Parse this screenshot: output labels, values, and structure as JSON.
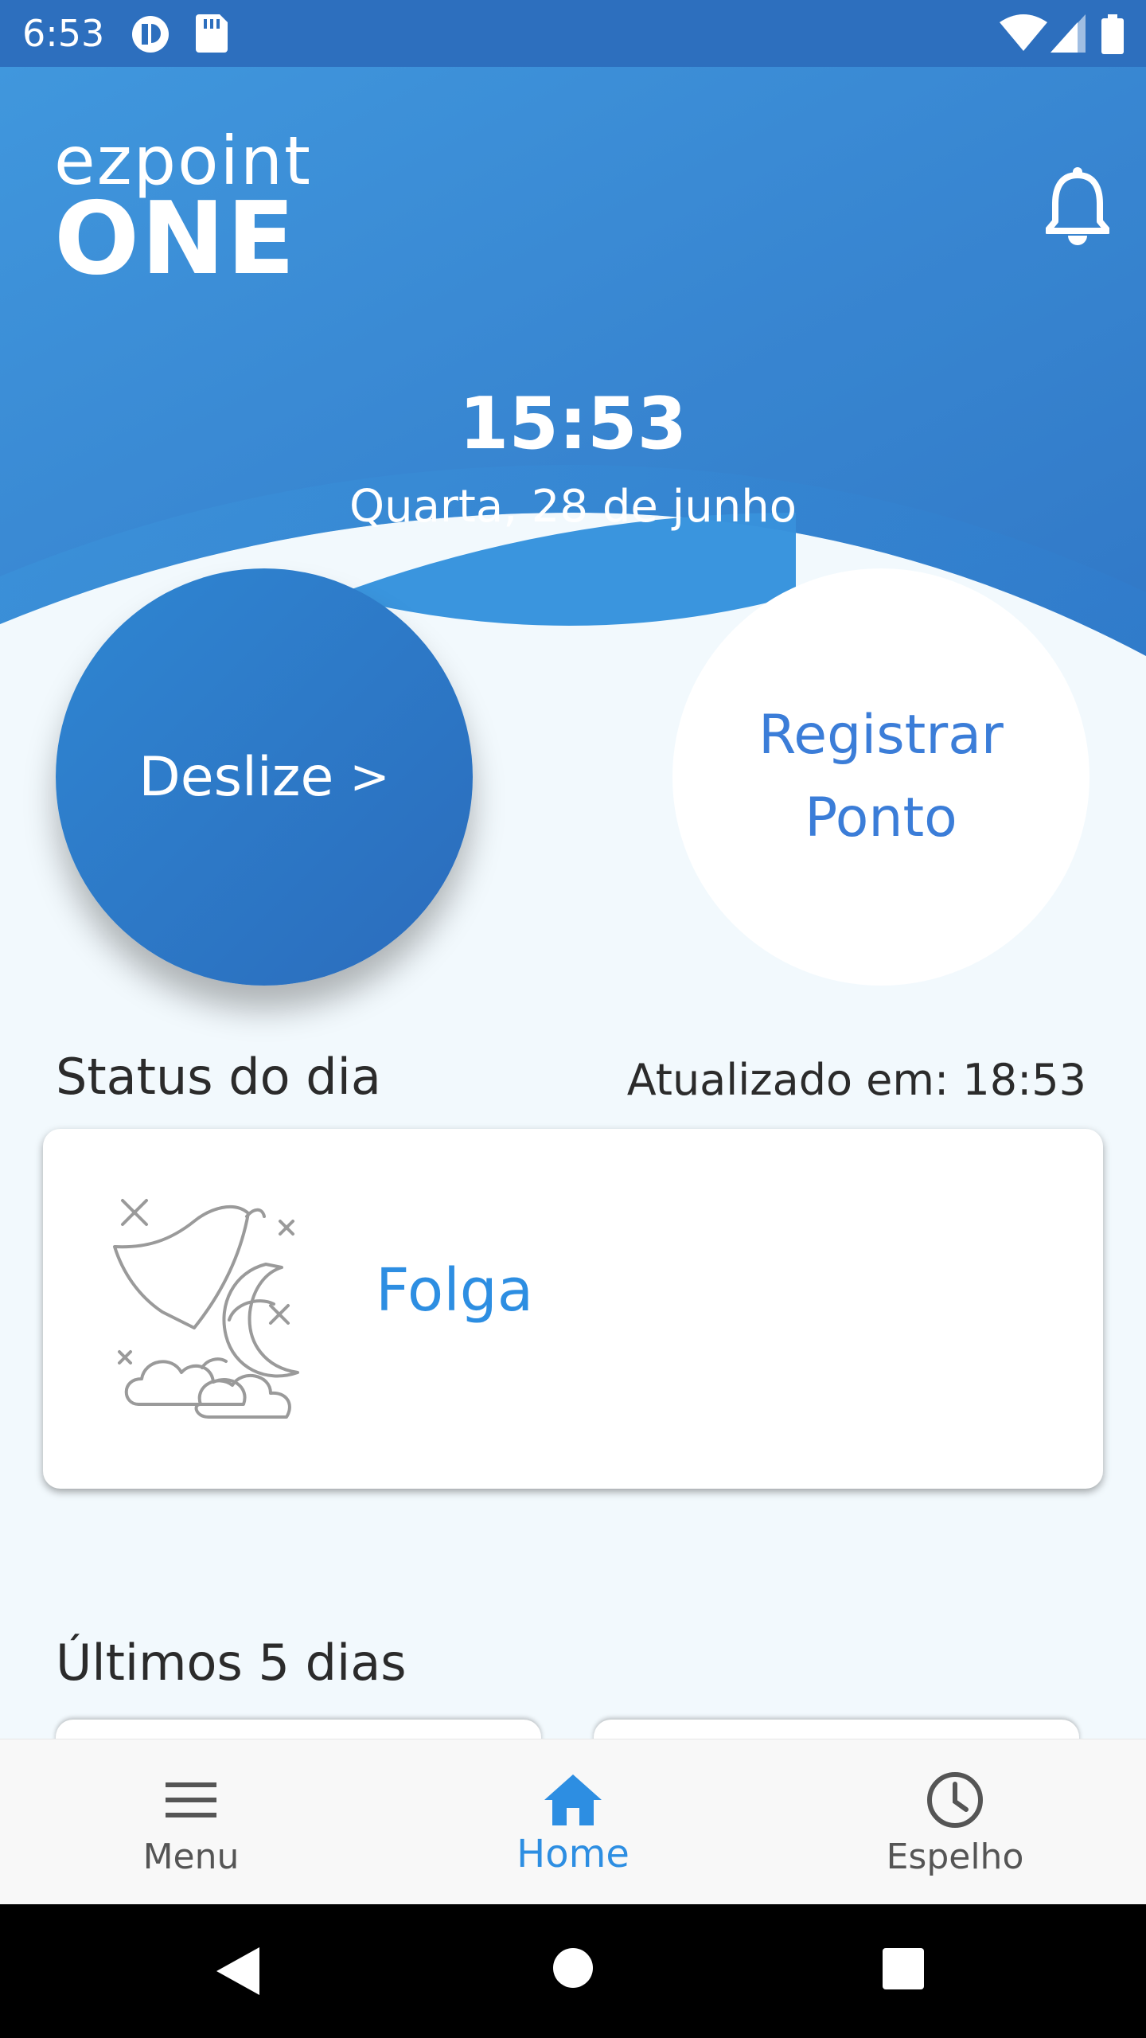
{
  "status_bar": {
    "time": "6:53"
  },
  "header": {
    "logo_top": "ezpoint",
    "logo_bottom": "ONE",
    "clock": "15:53",
    "date": "Quarta, 28 de junho"
  },
  "actions": {
    "slide_label": "Deslize",
    "slide_arrow": ">",
    "register_line1": "Registrar",
    "register_line2": "Ponto"
  },
  "status": {
    "title": "Status do dia",
    "updated": "Atualizado em: 18:53",
    "value": "Folga"
  },
  "history": {
    "title": "Últimos 5 dias"
  },
  "bottom_nav": {
    "items": [
      {
        "label": "Menu",
        "icon": "menu-icon"
      },
      {
        "label": "Home",
        "icon": "home-icon",
        "active": true
      },
      {
        "label": "Espelho",
        "icon": "clock-icon"
      }
    ]
  },
  "colors": {
    "primary": "#2f86d2",
    "accent": "#3b7dd8",
    "active_nav": "#2d8ee2",
    "status_bar": "#2d6fbe"
  }
}
